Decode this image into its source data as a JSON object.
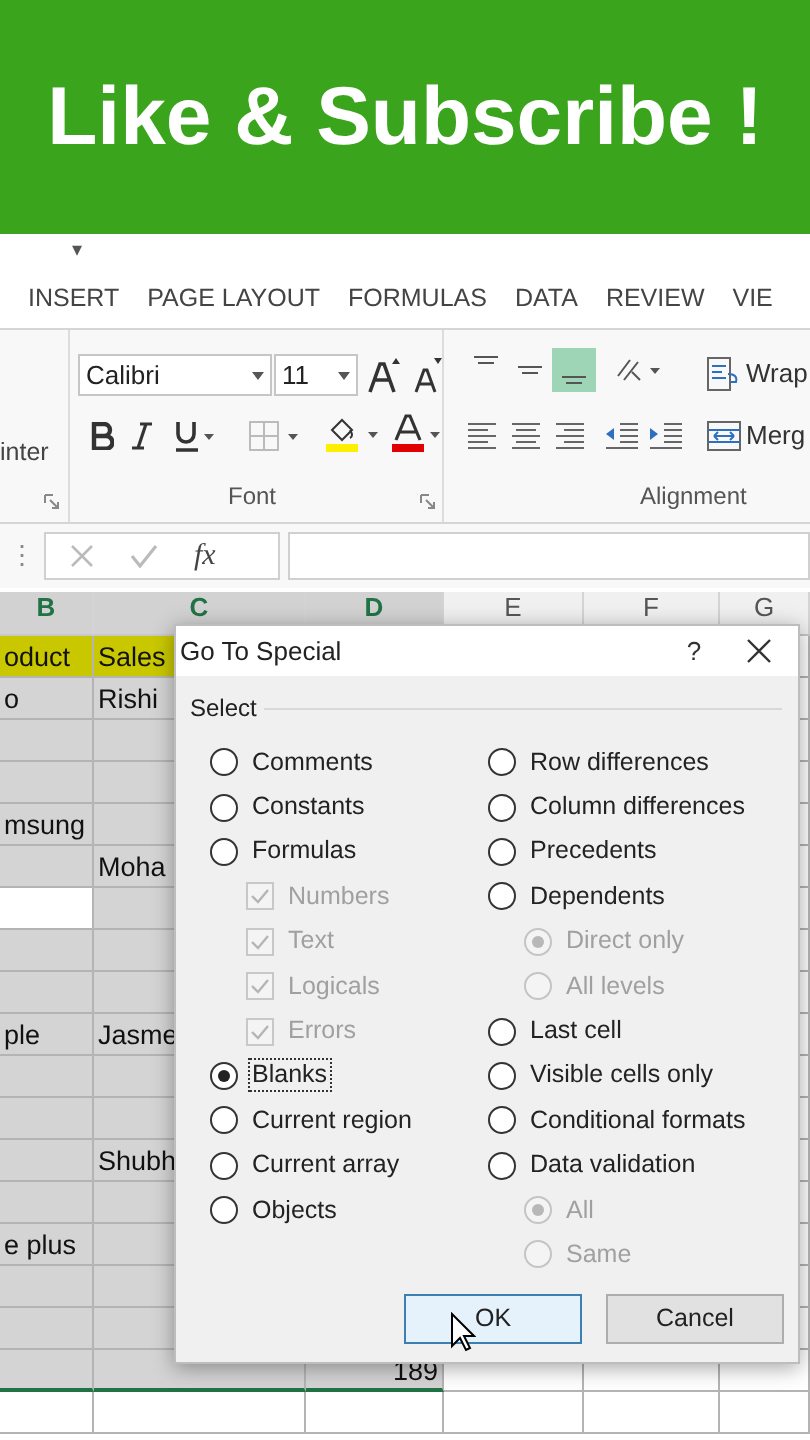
{
  "banner": {
    "text": "Like & Subscribe !"
  },
  "quick_access": {
    "glyph": "▾"
  },
  "tabs": [
    {
      "label": "INSERT",
      "selected": false
    },
    {
      "label": "PAGE LAYOUT",
      "selected": false
    },
    {
      "label": "FORMULAS",
      "selected": false
    },
    {
      "label": "DATA",
      "selected": false
    },
    {
      "label": "REVIEW",
      "selected": false
    },
    {
      "label": "VIE",
      "selected": false
    }
  ],
  "ribbon": {
    "clipboard_label": "inter",
    "font_name": "Calibri",
    "font_size": "11",
    "font_label": "Font",
    "vertical_align": [
      {
        "selected": false
      },
      {
        "selected": false
      },
      {
        "selected": true
      }
    ],
    "wrap": "Wrap",
    "merge": "Merg",
    "alignment_label": "Alignment"
  },
  "formula_bar": {
    "more": "⋮",
    "fx": "fx"
  },
  "sheet": {
    "columns": [
      "B",
      "C",
      "D",
      "E",
      "F",
      "G"
    ],
    "rows": [
      {
        "kind": "header",
        "b": "oduct",
        "c": "Sales"
      },
      {
        "selected": true,
        "b": "o",
        "c": "Rishi"
      },
      {
        "selected": true
      },
      {
        "selected": true
      },
      {
        "selected": true,
        "b": "msung"
      },
      {
        "selected": true,
        "c": "Moha"
      },
      {
        "selected": true,
        "active": true
      },
      {
        "selected": true
      },
      {
        "selected": true
      },
      {
        "selected": true,
        "b": "ple",
        "c": "Jasme"
      },
      {
        "selected": true
      },
      {
        "selected": true
      },
      {
        "selected": true,
        "c": "Shubh"
      },
      {
        "selected": true
      },
      {
        "selected": true,
        "b": "e plus"
      },
      {
        "selected": true
      },
      {
        "selected": true
      },
      {
        "selected": true,
        "d": "189"
      },
      {
        "selected": false
      }
    ]
  },
  "dialog": {
    "title": "Go To Special",
    "help": "?",
    "group": "Select",
    "left": [
      {
        "label": "Comments",
        "kind": "radio",
        "selected": false
      },
      {
        "label": "Constants",
        "kind": "radio",
        "selected": false
      },
      {
        "label": "Formulas",
        "kind": "radio",
        "selected": false,
        "children": [
          {
            "label": "Numbers",
            "kind": "checkbox",
            "checked": true,
            "disabled": true
          },
          {
            "label": "Text",
            "kind": "checkbox",
            "checked": true,
            "disabled": true
          },
          {
            "label": "Logicals",
            "kind": "checkbox",
            "checked": true,
            "disabled": true
          },
          {
            "label": "Errors",
            "kind": "checkbox",
            "checked": true,
            "disabled": true
          }
        ]
      },
      {
        "label": "Blanks",
        "kind": "radio",
        "selected": true,
        "focused": true
      },
      {
        "label": "Current region",
        "kind": "radio",
        "selected": false
      },
      {
        "label": "Current array",
        "kind": "radio",
        "selected": false
      },
      {
        "label": "Objects",
        "kind": "radio",
        "selected": false
      }
    ],
    "right": [
      {
        "label": "Row differences",
        "kind": "radio",
        "selected": false
      },
      {
        "label": "Column differences",
        "kind": "radio",
        "selected": false
      },
      {
        "label": "Precedents",
        "kind": "radio",
        "selected": false
      },
      {
        "label": "Dependents",
        "kind": "radio",
        "selected": false,
        "children": [
          {
            "label": "Direct only",
            "kind": "radio",
            "selected": true,
            "disabled": true
          },
          {
            "label": "All levels",
            "kind": "radio",
            "selected": false,
            "disabled": true
          }
        ]
      },
      {
        "label": "Last cell",
        "kind": "radio",
        "selected": false
      },
      {
        "label": "Visible cells only",
        "kind": "radio",
        "selected": false
      },
      {
        "label": "Conditional formats",
        "kind": "radio",
        "selected": false
      },
      {
        "label": "Data validation",
        "kind": "radio",
        "selected": false,
        "children": [
          {
            "label": "All",
            "kind": "radio",
            "selected": true,
            "disabled": true
          },
          {
            "label": "Same",
            "kind": "radio",
            "selected": false,
            "disabled": true
          }
        ]
      }
    ],
    "buttons": [
      {
        "label": "OK",
        "default": true
      },
      {
        "label": "Cancel",
        "default": false
      }
    ]
  }
}
